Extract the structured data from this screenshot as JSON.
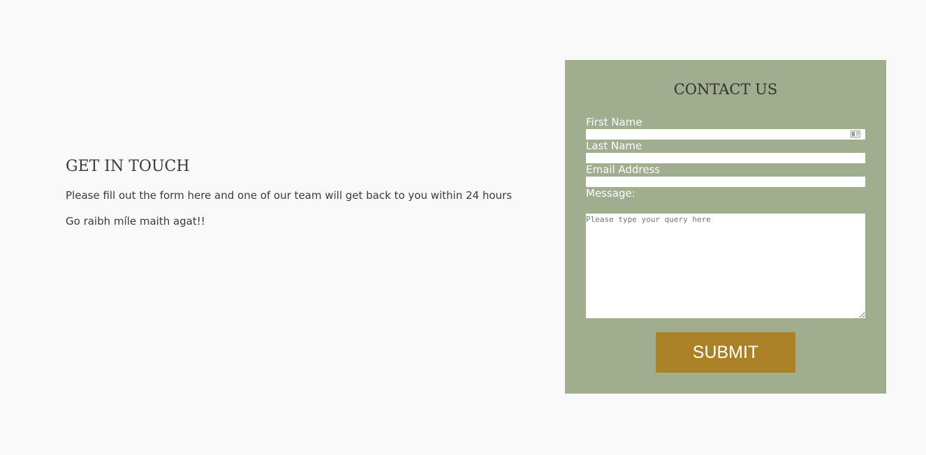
{
  "intro": {
    "heading": "GET IN TOUCH",
    "description": "Please fill out the form here and one of our team will get back to you within 24 hours",
    "blessing": "Go raibh míle maith agat!!"
  },
  "contact_form": {
    "title": "CONTACT US",
    "first_name_label": "First Name",
    "first_name_value": "",
    "last_name_label": "Last Name",
    "last_name_value": "",
    "email_label": "Email Address",
    "email_value": "",
    "message_label": "Message:",
    "message_placeholder": "Please type your query here",
    "submit_label": "SUBMIT"
  },
  "colors": {
    "page_background": "#f9f9f9",
    "form_background": "#a0ad8f",
    "submit_background": "#ab8128",
    "label_text": "#ffffff"
  },
  "icons": {
    "autofill": "contact-card-icon"
  }
}
